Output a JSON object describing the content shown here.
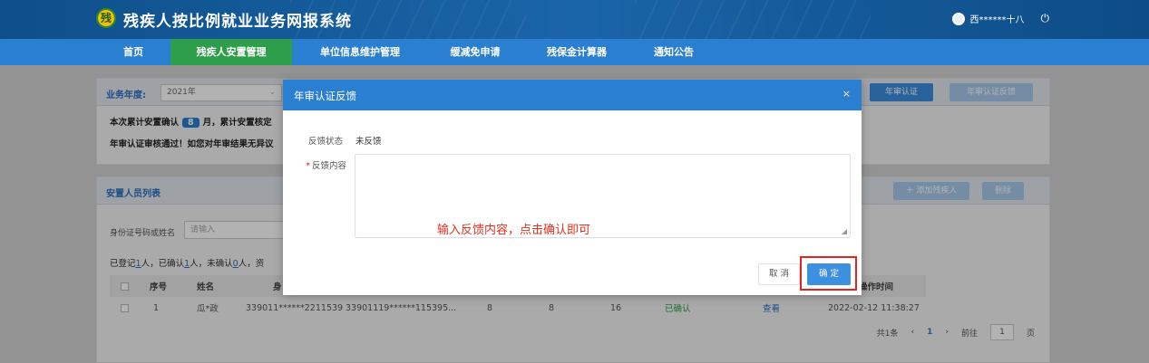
{
  "header": {
    "logo_glyph": "残",
    "title": "残疾人按比例就业业务网报系统",
    "user_name": "西******十八",
    "power_glyph": "⏻"
  },
  "nav": {
    "items": [
      {
        "label": "首页",
        "active": false
      },
      {
        "label": "残疾人安置管理",
        "active": true
      },
      {
        "label": "单位信息维护管理",
        "active": false
      },
      {
        "label": "缓减免申请",
        "active": false
      },
      {
        "label": "残保金计算器",
        "active": false
      },
      {
        "label": "通知公告",
        "active": false
      }
    ]
  },
  "top_card": {
    "year_label": "业务年度:",
    "year_value": "2021年",
    "annual_cert_button": "年审认证",
    "annual_feedback_button": "年审认证反馈",
    "summary_prefix": "本次累计安置确认",
    "months_value": "8",
    "summary_suffix": "月，累计安置核定",
    "notice_text": "年审认证审核通过！如您对年审结果无异议"
  },
  "list_card": {
    "title": "安置人员列表",
    "add_button": "＋ 添加残疾人",
    "delete_button": "删除",
    "filter_label": "身份证号码或姓名",
    "filter_placeholder": "请输入",
    "stats_prefix": "已登记",
    "registered": "1",
    "stats_mid1": "人，已确认",
    "confirmed": "1",
    "stats_mid2": "人，未确认",
    "unconfirmed": "0",
    "stats_suffix": "人，资",
    "columns": [
      "序号",
      "姓名",
      "身",
      "操作时间"
    ],
    "rows": [
      {
        "index": "1",
        "name": "瓜*政",
        "id_no": "339011******2211539",
        "card_no": "33901119******115395...",
        "c1": "8",
        "c2": "8",
        "c3": "16",
        "status": "已确认",
        "action": "查看",
        "time": "2022-02-12 11:38:27"
      }
    ],
    "pager": {
      "total": "共1条",
      "prev": "‹",
      "page": "1",
      "next": "›",
      "goto_label": "前往",
      "goto_value": "1",
      "page_unit": "页"
    }
  },
  "dialog": {
    "title": "年审认证反馈",
    "close_glyph": "×",
    "status_label": "反馈状态",
    "status_value": "未反馈",
    "content_label": "反馈内容",
    "content_value": "",
    "hint": "输入反馈内容，点击确认即可",
    "cancel_button": "取 消",
    "ok_button": "确 定"
  }
}
